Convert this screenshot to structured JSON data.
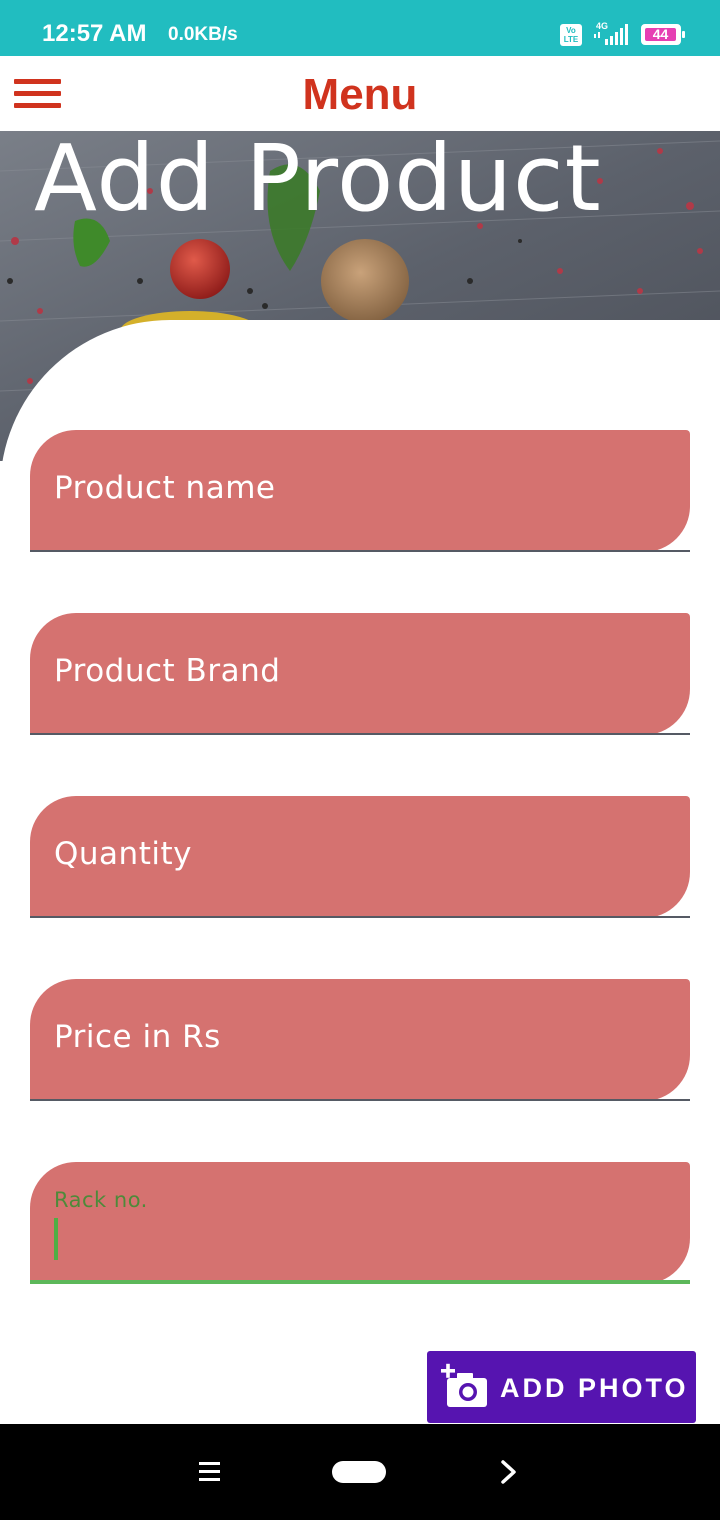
{
  "status_bar": {
    "time": "12:57 AM",
    "network_speed": "0.0KB/s",
    "volte_label": "Vo LTE",
    "network_type": "4G",
    "battery_level": "44"
  },
  "app_bar": {
    "title": "Menu",
    "menu_icon": "hamburger-menu-icon"
  },
  "hero": {
    "title": "Add Product"
  },
  "form": {
    "fields": [
      {
        "label": "Product name",
        "value": "",
        "focused": false
      },
      {
        "label": "Product Brand",
        "value": "",
        "focused": false
      },
      {
        "label": "Quantity",
        "value": "",
        "focused": false
      },
      {
        "label": "Price in Rs",
        "value": "",
        "focused": false
      },
      {
        "label": "Rack no.",
        "value": "",
        "focused": true
      }
    ]
  },
  "add_photo_button": {
    "label": "ADD PHOTO",
    "icon": "add-a-photo-icon"
  },
  "nav_bar": {
    "icons": [
      "recents-menu-icon",
      "home-pill-icon",
      "back-chevron-icon"
    ]
  },
  "colors": {
    "status_bar": "#21bdc0",
    "app_bar_accent": "#d0331e",
    "field_background": "#d57270",
    "button_background": "#5614b0",
    "focus_green": "#5cb85a"
  }
}
